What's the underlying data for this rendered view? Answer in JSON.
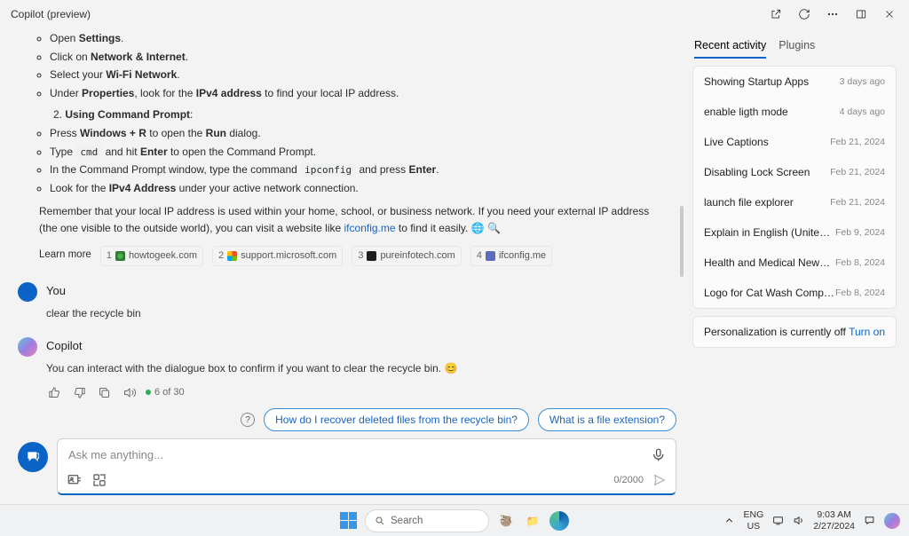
{
  "title": "Copilot (preview)",
  "content": {
    "sub1": [
      {
        "pre": "Open ",
        "b": "Settings",
        "post": "."
      },
      {
        "pre": "Click on ",
        "b": "Network & Internet",
        "post": "."
      },
      {
        "pre": "Select your ",
        "b": "Wi-Fi Network",
        "post": "."
      },
      {
        "pre": "Under ",
        "b": "Properties",
        "mid": ", look for the ",
        "b2": "IPv4 address",
        "post": " to find your local IP address."
      }
    ],
    "step2_num": "2.",
    "step2": "Using Command Prompt",
    "sub2": [
      {
        "pre": "Press ",
        "b": "Windows + R",
        "mid": " to open the ",
        "b2": "Run",
        "post": " dialog."
      },
      {
        "pre": "Type ",
        "code": "cmd",
        "mid": " and hit ",
        "b2": "Enter",
        "post": " to open the Command Prompt."
      },
      {
        "pre": "In the Command Prompt window, type the command ",
        "code": "ipconfig",
        "mid": " and press ",
        "b2": "Enter",
        "post": "."
      },
      {
        "pre": "Look for the ",
        "b": "IPv4 Address",
        "post": " under your active network connection."
      }
    ],
    "para_a": "Remember that your local IP address is used within your home, school, or business network. If you need your external IP address (the one visible to the outside world), you can visit a website like ",
    "para_link": "ifconfig.me",
    "para_b": " to find it easily. 🌐 🔍",
    "learnmore_label": "Learn more",
    "sources": [
      {
        "n": "1",
        "fav": "fav1",
        "txt": "howtogeek.com"
      },
      {
        "n": "2",
        "fav": "fav2",
        "txt": "support.microsoft.com"
      },
      {
        "n": "3",
        "fav": "fav3",
        "txt": "pureinfotech.com"
      },
      {
        "n": "4",
        "fav": "fav4",
        "txt": "ifconfig.me"
      }
    ]
  },
  "you": {
    "name": "You",
    "msg": "clear the recycle bin"
  },
  "copilot": {
    "name": "Copilot",
    "msg": "You can interact with the dialogue box to confirm if you want to clear the recycle bin. 😊",
    "steps": "6 of 30"
  },
  "chips": {
    "c1": "How do I recover deleted files from the recycle bin?",
    "c2": "What is a file extension?"
  },
  "input": {
    "placeholder": "Ask me anything...",
    "counter": "0/2000"
  },
  "tabs": {
    "recent": "Recent activity",
    "plugins": "Plugins"
  },
  "recent": [
    {
      "t": "Showing Startup Apps",
      "d": "3 days ago"
    },
    {
      "t": "enable ligth mode",
      "d": "4 days ago"
    },
    {
      "t": "Live Captions",
      "d": "Feb 21, 2024"
    },
    {
      "t": "Disabling Lock Screen",
      "d": "Feb 21, 2024"
    },
    {
      "t": "launch file explorer",
      "d": "Feb 21, 2024"
    },
    {
      "t": "Explain in English (United States): LTPO",
      "d": "Feb 9, 2024"
    },
    {
      "t": "Health and Medical News Updates",
      "d": "Feb 8, 2024"
    },
    {
      "t": "Logo for Cat Wash Company",
      "d": "Feb 8, 2024"
    }
  ],
  "pers": {
    "txt": "Personalization is currently off",
    "action": "Turn on"
  },
  "taskbar": {
    "search": "Search",
    "lang1": "ENG",
    "lang2": "US",
    "time": "9:03 AM",
    "date": "2/27/2024"
  }
}
